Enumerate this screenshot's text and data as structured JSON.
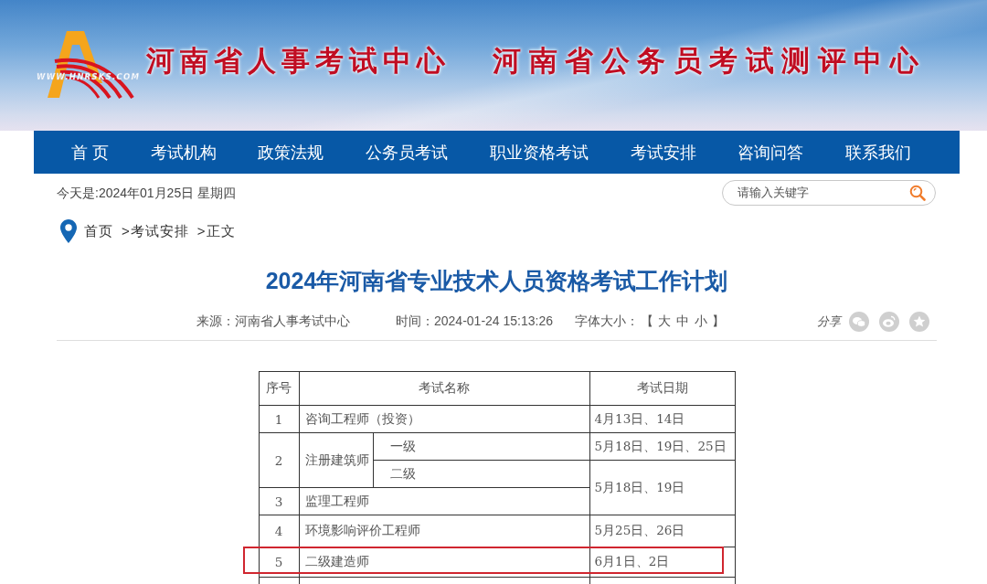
{
  "header": {
    "logo_text": "WWW.HNRSKS.COM",
    "titles": [
      "河南省人事考试中心",
      "河南省公务员考试测评中心"
    ]
  },
  "nav": {
    "items": [
      {
        "label": "首 页"
      },
      {
        "label": "考试机构"
      },
      {
        "label": "政策法规"
      },
      {
        "label": "公务员考试"
      },
      {
        "label": "职业资格考试"
      },
      {
        "label": "考试安排"
      },
      {
        "label": "咨询问答"
      },
      {
        "label": "联系我们"
      }
    ]
  },
  "date_line": "今天是:2024年01月25日 星期四",
  "search": {
    "placeholder": "请输入关键字"
  },
  "breadcrumb": [
    {
      "label": "首页"
    },
    {
      "label": ">考试安排"
    },
    {
      "label": ">正文"
    }
  ],
  "article": {
    "title": "2024年河南省专业技术人员资格考试工作计划",
    "source": "来源：河南省人事考试中心",
    "time": "时间：2024-01-24 15:13:26",
    "font_size": {
      "label": "字体大小：",
      "bracket_open": "【",
      "options": [
        "大",
        "中",
        "小"
      ],
      "bracket_close": "】"
    },
    "share_label": "分享"
  },
  "table": {
    "columns": [
      "序号",
      "考试名称",
      "考试日期"
    ],
    "rows": [
      {
        "number": "1",
        "name": "咨询工程师（投资）",
        "date": "4月13日、14日",
        "highlighted": false
      },
      {
        "number": "2",
        "name": "注册建筑师",
        "level": "一级",
        "date": "5月18日、19日、25日",
        "highlighted": false
      },
      {
        "level": "二级",
        "date": "5月18日、19日",
        "highlighted": false
      },
      {
        "number": "3",
        "name": "监理工程师",
        "highlighted": false
      },
      {
        "number": "4",
        "name": "环境影响评价工程师",
        "date": "5月25日、26日",
        "highlighted": false
      },
      {
        "number": "5",
        "name": "二级建造师",
        "date": "6月1日、2日",
        "highlighted": true
      }
    ]
  }
}
